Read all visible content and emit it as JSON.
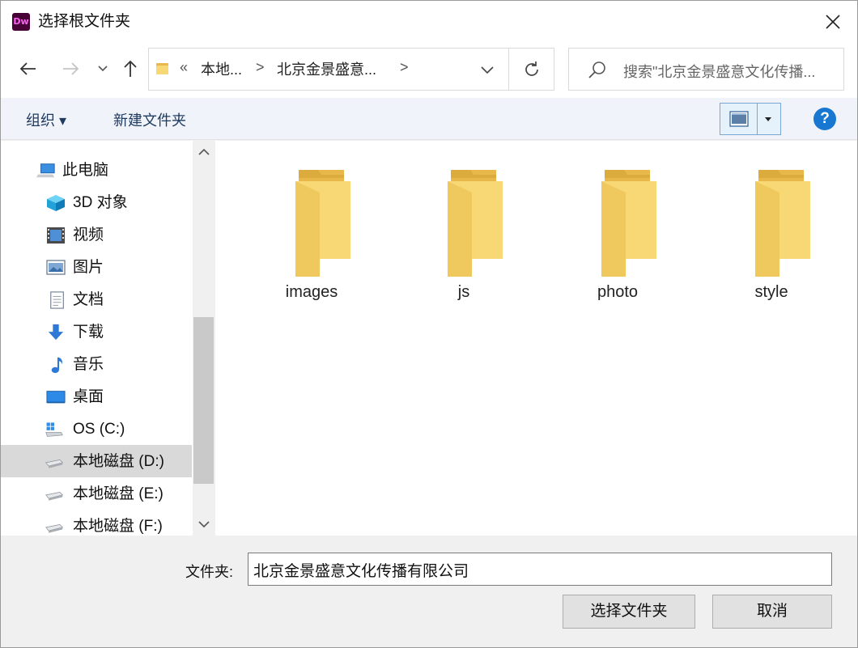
{
  "window": {
    "app_icon_text": "Dw",
    "title": "选择根文件夹"
  },
  "address_bar": {
    "overflow": "«",
    "crumb1": "本地...",
    "crumb2": "北京金景盛意...",
    "separator": ">"
  },
  "search": {
    "placeholder": "搜索\"北京金景盛意文化传播..."
  },
  "toolbar": {
    "organize_label": "组织 ▾",
    "new_folder_label": "新建文件夹",
    "help_label": "?"
  },
  "nav_pane": {
    "items": [
      {
        "label": "此电脑",
        "icon": "computer-icon"
      },
      {
        "label": "3D 对象",
        "icon": "3d-objects-icon"
      },
      {
        "label": "视频",
        "icon": "videos-icon"
      },
      {
        "label": "图片",
        "icon": "pictures-icon"
      },
      {
        "label": "文档",
        "icon": "documents-icon"
      },
      {
        "label": "下载",
        "icon": "downloads-icon"
      },
      {
        "label": "音乐",
        "icon": "music-icon"
      },
      {
        "label": "桌面",
        "icon": "desktop-icon"
      },
      {
        "label": "OS (C:)",
        "icon": "windows-drive-icon"
      },
      {
        "label": "本地磁盘 (D:)",
        "icon": "drive-icon",
        "selected": true
      },
      {
        "label": "本地磁盘 (E:)",
        "icon": "drive-icon"
      },
      {
        "label": "本地磁盘 (F:)",
        "icon": "drive-icon"
      }
    ]
  },
  "folders": [
    {
      "name": "images"
    },
    {
      "name": "js"
    },
    {
      "name": "photo"
    },
    {
      "name": "style"
    }
  ],
  "bottom": {
    "folder_label": "文件夹:",
    "folder_value": "北京金景盛意文化传播有限公司",
    "select_button": "选择文件夹",
    "cancel_button": "取消"
  },
  "colors": {
    "folder_front": "#f8d775",
    "folder_back": "#e8b84a",
    "help_blue": "#1877d1",
    "selection_gray": "#d9d9d9"
  }
}
